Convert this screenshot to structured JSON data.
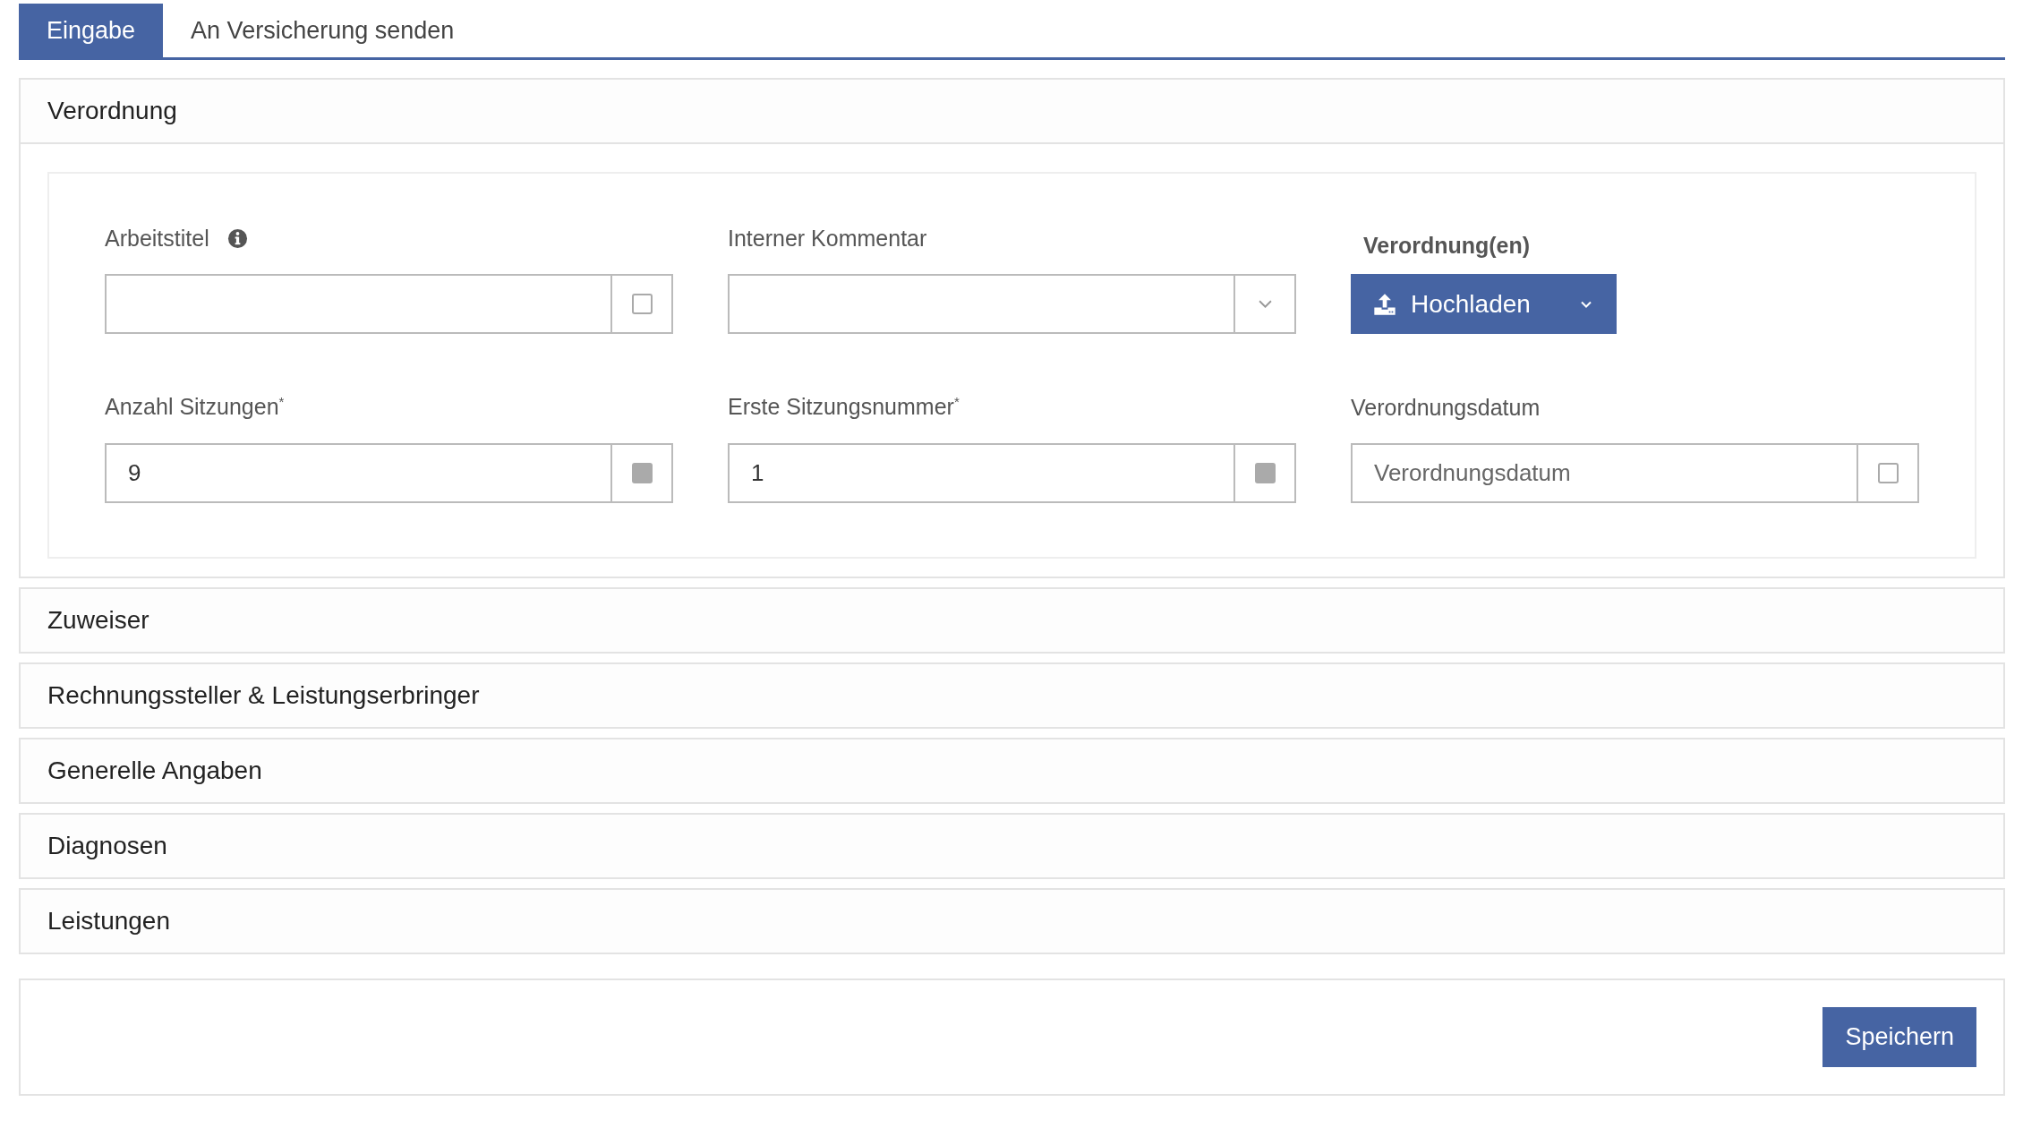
{
  "tabs": [
    {
      "label": "Eingabe",
      "selected": true
    },
    {
      "label": "An Versicherung senden",
      "selected": false
    }
  ],
  "sections": [
    {
      "title": "Verordnung",
      "expanded": true,
      "fields": [
        {
          "kind": "input",
          "label": "Arbeitstitel",
          "info": true,
          "addon": {
            "kind": "checkbox",
            "checked": false
          }
        },
        {
          "kind": "input",
          "label": "Interner Kommentar",
          "addon": {
            "kind": "dropdown"
          }
        },
        {
          "kind": "upload",
          "label": "Verordnung(en)",
          "button": "Hochladen"
        },
        {
          "kind": "input",
          "label": "Anzahl Sitzungen$^{*}$",
          "value": "9",
          "addon": {
            "kind": "checkbox",
            "checked": true
          }
        },
        {
          "kind": "input",
          "label": "Erste Sitzungsnummer$^{*}$",
          "value": "1",
          "addon": {
            "kind": "checkbox",
            "checked": true
          }
        },
        {
          "kind": "input",
          "label": "Verordnungsdatum",
          "placeholder": "Verordnungsdatum",
          "addon": {
            "kind": "checkbox",
            "checked": false
          }
        }
      ]
    },
    {
      "title": "Zuweiser",
      "expanded": false
    },
    {
      "title": "Rechnungssteller & Leistungserbringer",
      "expanded": false
    },
    {
      "title": "Generelle Angaben",
      "expanded": false
    },
    {
      "title": "Diagnosen",
      "expanded": false
    },
    {
      "title": "Leistungen",
      "expanded": false
    }
  ],
  "footer": {
    "save_button": "Speichern"
  }
}
